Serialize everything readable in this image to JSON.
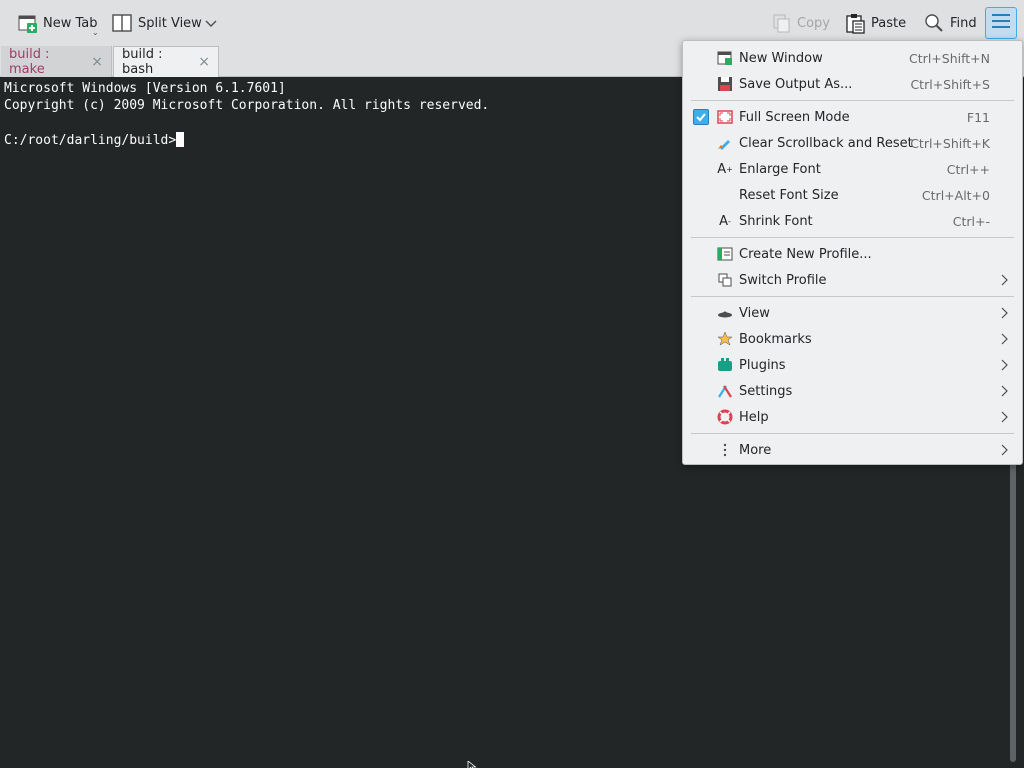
{
  "toolbar": {
    "new_tab": "New Tab",
    "split_view": "Split View",
    "copy": "Copy",
    "paste": "Paste",
    "find": "Find"
  },
  "tabs": [
    {
      "label": "build : make",
      "active": false
    },
    {
      "label": "build : bash",
      "active": true
    }
  ],
  "terminal": {
    "lines": [
      "Microsoft Windows [Version 6.1.7601]",
      "Copyright (c) 2009 Microsoft Corporation. All rights reserved.",
      "",
      "C:/root/darling/build>"
    ]
  },
  "menu": {
    "items": [
      {
        "label": "New Window",
        "shortcut": "Ctrl+Shift+N",
        "icon": "new-window-icon"
      },
      {
        "label": "Save Output As...",
        "shortcut": "Ctrl+Shift+S",
        "icon": "save-icon"
      },
      {
        "label": "Full Screen Mode",
        "shortcut": "F11",
        "icon": "fullscreen-icon",
        "checked": true
      },
      {
        "label": "Clear Scrollback and Reset",
        "shortcut": "Ctrl+Shift+K",
        "icon": "clear-icon"
      },
      {
        "label": "Enlarge Font",
        "shortcut": "Ctrl++",
        "icon": "enlarge-font-icon"
      },
      {
        "label": "Reset Font Size",
        "shortcut": "Ctrl+Alt+0",
        "icon": ""
      },
      {
        "label": "Shrink Font",
        "shortcut": "Ctrl+-",
        "icon": "shrink-font-icon"
      },
      {
        "label": "Create New Profile...",
        "shortcut": "",
        "icon": "new-profile-icon"
      },
      {
        "label": "Switch Profile",
        "shortcut": "",
        "icon": "switch-profile-icon",
        "submenu": true
      },
      {
        "label": "View",
        "shortcut": "",
        "icon": "view-icon",
        "submenu": true
      },
      {
        "label": "Bookmarks",
        "shortcut": "",
        "icon": "bookmarks-icon",
        "submenu": true
      },
      {
        "label": "Plugins",
        "shortcut": "",
        "icon": "plugins-icon",
        "submenu": true
      },
      {
        "label": "Settings",
        "shortcut": "",
        "icon": "settings-icon",
        "submenu": true
      },
      {
        "label": "Help",
        "shortcut": "",
        "icon": "help-icon",
        "submenu": true
      },
      {
        "label": "More",
        "shortcut": "",
        "icon": "more-icon",
        "submenu": true
      }
    ]
  },
  "colors": {
    "terminal_bg": "#232627",
    "accent": "#3daee9",
    "inactive_tab_text": "#9f3d67"
  }
}
